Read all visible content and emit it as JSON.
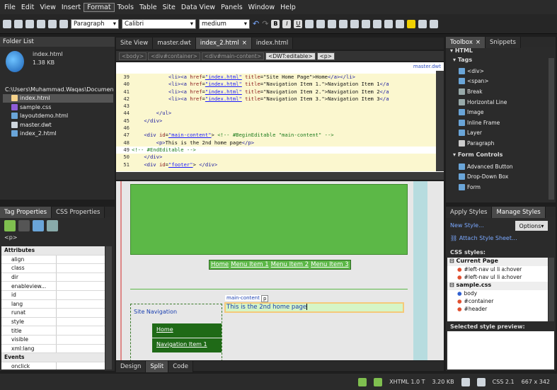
{
  "menu": [
    "File",
    "Edit",
    "View",
    "Insert",
    "Format",
    "Tools",
    "Table",
    "Site",
    "Data View",
    "Panels",
    "Window",
    "Help"
  ],
  "toolbar": {
    "style_select": "Paragraph",
    "font_select": "Calibri",
    "size_select": "medium"
  },
  "folder_list": {
    "title": "Folder List",
    "preview_file": "index.html",
    "preview_size": "1.38 KB",
    "root": "C:\\Users\\Muhammad.Waqas\\Documents\\M",
    "files": [
      "index.html",
      "sample.css",
      "layoutdemo.html",
      "master.dwt",
      "index_2.html"
    ]
  },
  "tag_props": {
    "tab1": "Tag Properties",
    "tab2": "CSS Properties",
    "tag": "<p>",
    "attributes_header": "Attributes",
    "attributes": [
      "align",
      "class",
      "dir",
      "enableview...",
      "id",
      "lang",
      "runat",
      "style",
      "title",
      "visible",
      "xml:lang"
    ],
    "events_header": "Events",
    "events": [
      "onclick"
    ]
  },
  "doc_tabs": [
    "Site View",
    "master.dwt",
    "index_2.html",
    "index.html"
  ],
  "breadcrumb": [
    "<body>",
    "<div#container>",
    "<div#main-content>",
    "<DWT:editable>",
    "<p>"
  ],
  "code_label": "master.dwt",
  "code_lines": [
    {
      "n": "39",
      "html": "            <span class='tag'>&lt;li&gt;&lt;a</span> <span class='attr'>href</span>=<span class='val'>\"index.html\"</span> <span class='attr'>title</span>=\"Site Home Page\"&gt;Home<span class='tag'>&lt;/a&gt;&lt;/li&gt;</span>"
    },
    {
      "n": "40",
      "html": "            <span class='tag'>&lt;li&gt;&lt;a</span> <span class='attr'>href</span>=<span class='val'>\"index.html\"</span> <span class='attr'>title</span>=\"Navigation Item 1.\"&gt;Navigation Item 1<span class='tag'>&lt;/a</span>"
    },
    {
      "n": "41",
      "html": "            <span class='tag'>&lt;li&gt;&lt;a</span> <span class='attr'>href</span>=<span class='val'>\"index.html\"</span> <span class='attr'>title</span>=\"Navigation Item 2.\"&gt;Navigation Item 2<span class='tag'>&lt;/a</span>"
    },
    {
      "n": "42",
      "html": "            <span class='tag'>&lt;li&gt;&lt;a</span> <span class='attr'>href</span>=<span class='val'>\"index.html\"</span> <span class='attr'>title</span>=\"Navigation Item 3.\"&gt;Navigation Item 3<span class='tag'>&lt;/a</span>"
    },
    {
      "n": "43",
      "html": ""
    },
    {
      "n": "44",
      "html": "        <span class='tag'>&lt;/ul&gt;</span>"
    },
    {
      "n": "45",
      "html": "    <span class='tag'>&lt;/div&gt;</span>"
    },
    {
      "n": "46",
      "html": ""
    },
    {
      "n": "47",
      "html": "    <span class='tag'>&lt;div</span> <span class='attr'>id</span>=<span class='val'>\"main-content\"</span>&gt; <span class='cm'>&lt;!-- #BeginEditable \"main-content\" --&gt;</span>"
    },
    {
      "n": "48",
      "html": "        <span class='tag'>&lt;p&gt;</span>This is the 2nd home page<span class='tag'>&lt;/p&gt;</span>"
    },
    {
      "n": "49",
      "html": "<span class='cm'>&lt;!-- #EndEditable --&gt;</span>"
    },
    {
      "n": "50",
      "html": "    <span class='tag'>&lt;/div&gt;</span>"
    },
    {
      "n": "51",
      "html": "    <span class='tag'>&lt;div</span> <span class='attr'>id</span>=<span class='val'>\"footer\"</span>&gt; <span class='tag'>&lt;/div&gt;</span>"
    }
  ],
  "design": {
    "nav_links": [
      "Home",
      "Menu Item 1",
      "Menu Item 2",
      "Menu Item 3"
    ],
    "site_nav": "Site Navigation",
    "side_links": [
      "Home",
      "Navigation Item 1"
    ],
    "main_label": "main-content",
    "p_label": "p",
    "main_text": "This is the 2nd home page"
  },
  "view_tabs": [
    "Design",
    "Split",
    "Code"
  ],
  "toolbox": {
    "tab1": "Toolbox",
    "tab2": "Snippets",
    "html": "HTML",
    "tags_header": "Tags",
    "tags": [
      "<div>",
      "<span>",
      "Break",
      "Horizontal Line",
      "Image",
      "Inline Frame",
      "Layer",
      "Paragraph"
    ],
    "form_header": "Form Controls",
    "form": [
      "Advanced Button",
      "Drop-Down Box",
      "Form"
    ]
  },
  "styles": {
    "tab1": "Apply Styles",
    "tab2": "Manage Styles",
    "new_style": "New Style...",
    "options": "Options",
    "attach": "Attach Style Sheet...",
    "css_styles": "CSS styles:",
    "current_page": "Current Page",
    "current_items": [
      "#left-nav ul li a:hover",
      "#left-nav ul li a:hover"
    ],
    "sample": "sample.css",
    "sample_items": [
      "body",
      "#container",
      "#header"
    ],
    "preview": "Selected style preview:"
  },
  "status": {
    "doctype": "XHTML 1.0 T",
    "size": "3.20 KB",
    "css": "CSS 2.1",
    "dims": "667 x 342"
  }
}
